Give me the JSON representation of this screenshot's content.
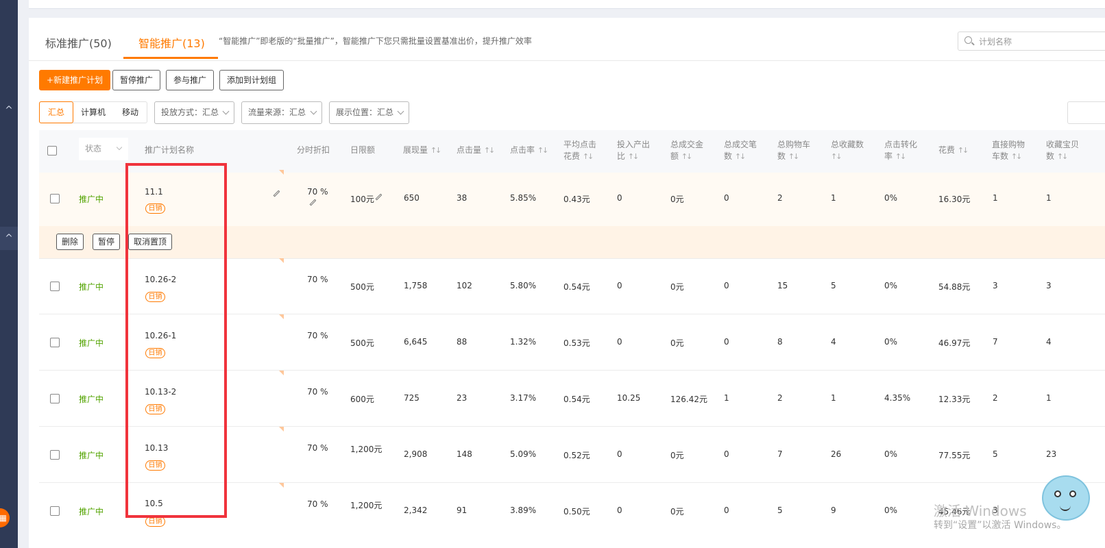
{
  "tabs": [
    {
      "label": "标准推广(50)"
    },
    {
      "label": "智能推广(13)"
    }
  ],
  "tab_description": "“智能推广”即老版的“批量推广”，智能推广下您只需批量设置基准出价，提升推广效率",
  "search": {
    "placeholder": "计划名称"
  },
  "toolbar": {
    "new_plan": "+新建推广计划",
    "pause": "暂停推广",
    "join": "参与推广",
    "add_to_group": "添加到计划组"
  },
  "device_segments": [
    "汇总",
    "计算机",
    "移动"
  ],
  "filters": [
    {
      "label": "投放方式：汇总"
    },
    {
      "label": "流量来源：汇总"
    },
    {
      "label": "展示位置：汇总"
    }
  ],
  "columns": {
    "status": "状态",
    "name": "推广计划名称",
    "discount": "分时折扣",
    "daily_limit": "日限额",
    "impressions": "展现量",
    "clicks": "点击量",
    "ctr": "点击率",
    "avg_cpc_1": "平均点击",
    "avg_cpc_2": "花费",
    "roi_1": "投入产出",
    "roi_2": "比",
    "gmv_1": "总成交金",
    "gmv_2": "额",
    "orders_1": "总成交笔",
    "orders_2": "数",
    "cart_1": "总购物车",
    "cart_2": "数",
    "fav_1": "总收藏数",
    "fav_2": "",
    "cvr_1": "点击转化",
    "cvr_2": "率",
    "cost": "花费",
    "direct_cart_1": "直接购物",
    "direct_cart_2": "车数",
    "fav_item_1": "收藏宝贝",
    "fav_item_2": "数",
    "sort_icon": "↑↓"
  },
  "row_actions": {
    "delete": "删除",
    "pause": "暂停",
    "unpin": "取消置顶"
  },
  "status_text": "推广中",
  "tag_text": "日销",
  "rows": [
    {
      "name": "11.1",
      "discount": "70 %",
      "daily_limit": "100元",
      "impressions": "650",
      "clicks": "38",
      "ctr": "5.85%",
      "avg_cpc": "0.43元",
      "roi": "0",
      "gmv": "0元",
      "orders": "0",
      "cart": "2",
      "fav": "1",
      "cvr": "0%",
      "cost": "16.30元",
      "direct_cart": "1",
      "fav_item": "1"
    },
    {
      "name": "10.26-2",
      "discount": "70 %",
      "daily_limit": "500元",
      "impressions": "1,758",
      "clicks": "102",
      "ctr": "5.80%",
      "avg_cpc": "0.54元",
      "roi": "0",
      "gmv": "0元",
      "orders": "0",
      "cart": "15",
      "fav": "5",
      "cvr": "0%",
      "cost": "54.88元",
      "direct_cart": "3",
      "fav_item": "3"
    },
    {
      "name": "10.26-1",
      "discount": "70 %",
      "daily_limit": "500元",
      "impressions": "6,645",
      "clicks": "88",
      "ctr": "1.32%",
      "avg_cpc": "0.53元",
      "roi": "0",
      "gmv": "0元",
      "orders": "0",
      "cart": "8",
      "fav": "4",
      "cvr": "0%",
      "cost": "46.97元",
      "direct_cart": "7",
      "fav_item": "4"
    },
    {
      "name": "10.13-2",
      "discount": "70 %",
      "daily_limit": "600元",
      "impressions": "725",
      "clicks": "23",
      "ctr": "3.17%",
      "avg_cpc": "0.54元",
      "roi": "10.25",
      "gmv": "126.42元",
      "orders": "1",
      "cart": "2",
      "fav": "1",
      "cvr": "4.35%",
      "cost": "12.33元",
      "direct_cart": "2",
      "fav_item": "1"
    },
    {
      "name": "10.13",
      "discount": "70 %",
      "daily_limit": "1,200元",
      "impressions": "2,908",
      "clicks": "148",
      "ctr": "5.09%",
      "avg_cpc": "0.52元",
      "roi": "0",
      "gmv": "0元",
      "orders": "0",
      "cart": "7",
      "fav": "26",
      "cvr": "0%",
      "cost": "77.55元",
      "direct_cart": "5",
      "fav_item": "23"
    },
    {
      "name": "10.5",
      "discount": "70 %",
      "daily_limit": "1,200元",
      "impressions": "2,342",
      "clicks": "91",
      "ctr": "3.89%",
      "avg_cpc": "0.50元",
      "roi": "0",
      "gmv": "0元",
      "orders": "0",
      "cart": "5",
      "fav": "9",
      "cvr": "0%",
      "cost": "45.46元",
      "direct_cart": "3",
      "fav_item": ""
    }
  ],
  "watermark": {
    "line1": "激活 Windows",
    "line2": "转到“设置”以激活 Windows。"
  },
  "colors": {
    "accent": "#ff7a00",
    "status_green": "#52a300",
    "highlight_red": "#f0333c"
  }
}
